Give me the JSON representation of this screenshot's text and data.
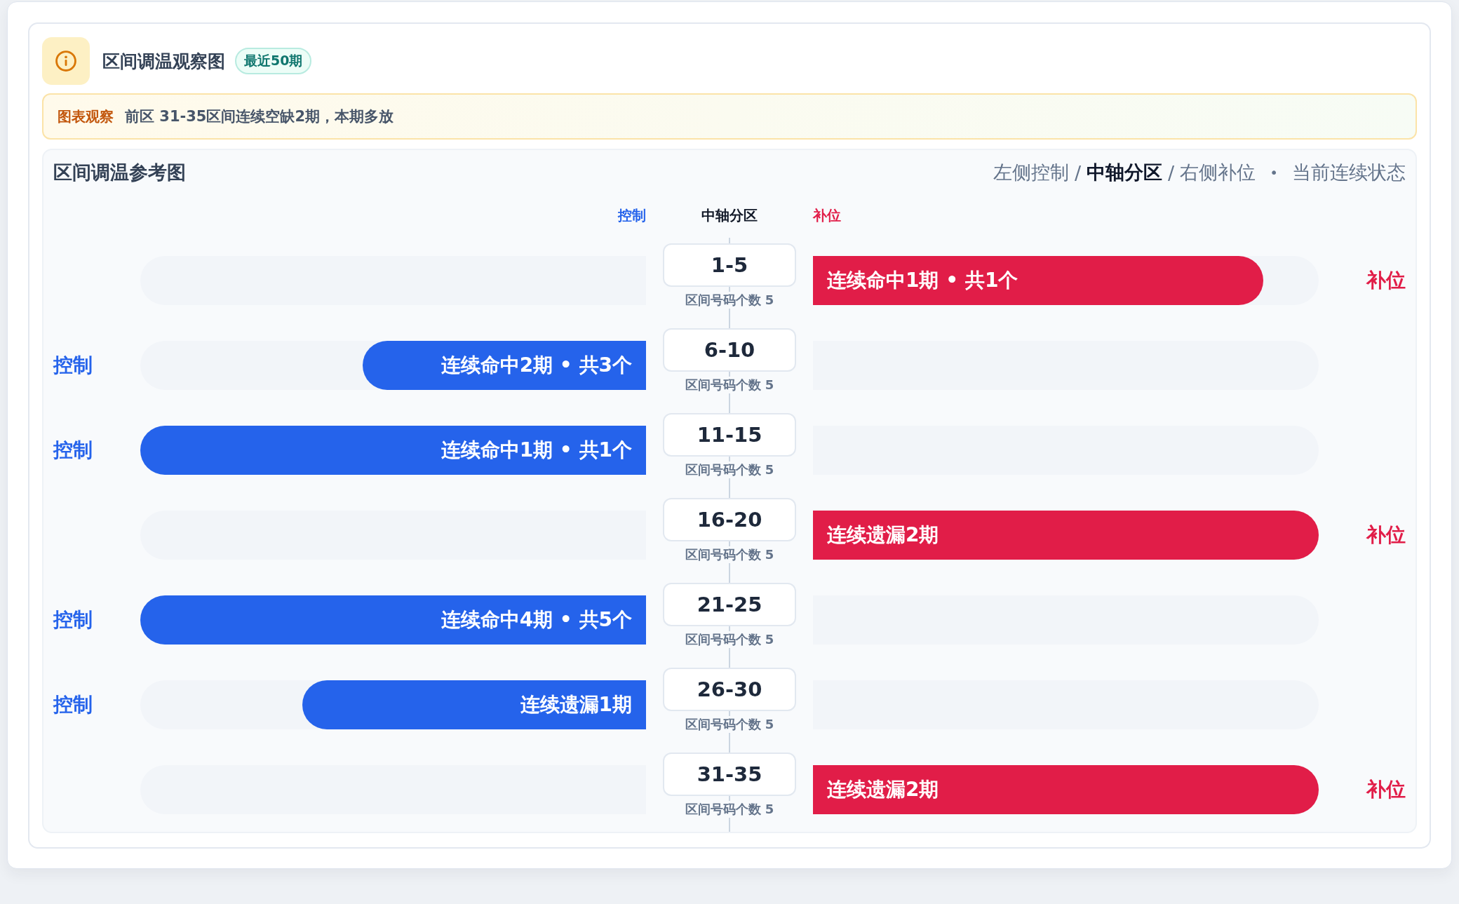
{
  "header": {
    "title": "区间调温观察图",
    "badge": "最近50期"
  },
  "notice": {
    "label": "图表观察",
    "text": "前区 31-35区间连续空缺2期，本期多放"
  },
  "panel": {
    "title": "区间调温参考图",
    "legend": [
      {
        "text": "左侧控制",
        "selected": false
      },
      {
        "text": "中轴分区",
        "selected": true
      },
      {
        "text": "右侧补位",
        "selected": false
      }
    ],
    "legend_separator": "/",
    "legend_note_separator": "•",
    "legend_note": "当前连续状态",
    "column_headers": {
      "left": "控制",
      "center": "中轴分区",
      "right": "补位"
    },
    "rows": [
      {
        "range": "1-5",
        "count_label": "区间号码个数 5",
        "kind": "supplement",
        "bar_text": "连续命中1期 • 共1个",
        "level": 0.89,
        "side_label": "补位"
      },
      {
        "range": "6-10",
        "count_label": "区间号码个数 5",
        "kind": "control",
        "bar_text": "连续命中2期 • 共3个",
        "level": 0.56,
        "side_label": "控制"
      },
      {
        "range": "11-15",
        "count_label": "区间号码个数 5",
        "kind": "control",
        "bar_text": "连续命中1期 • 共1个",
        "level": 1,
        "side_label": "控制"
      },
      {
        "range": "16-20",
        "count_label": "区间号码个数 5",
        "kind": "supplement",
        "bar_text": "连续遗漏2期",
        "level": 1,
        "side_label": "补位"
      },
      {
        "range": "21-25",
        "count_label": "区间号码个数 5",
        "kind": "control",
        "bar_text": "连续命中4期 • 共5个",
        "level": 1,
        "side_label": "控制"
      },
      {
        "range": "26-30",
        "count_label": "区间号码个数 5",
        "kind": "control",
        "bar_text": "连续遗漏1期",
        "level": 0.68,
        "side_label": "控制"
      },
      {
        "range": "31-35",
        "count_label": "区间号码个数 5",
        "kind": "supplement",
        "bar_text": "连续遗漏2期",
        "level": 1,
        "side_label": "补位"
      }
    ]
  }
}
